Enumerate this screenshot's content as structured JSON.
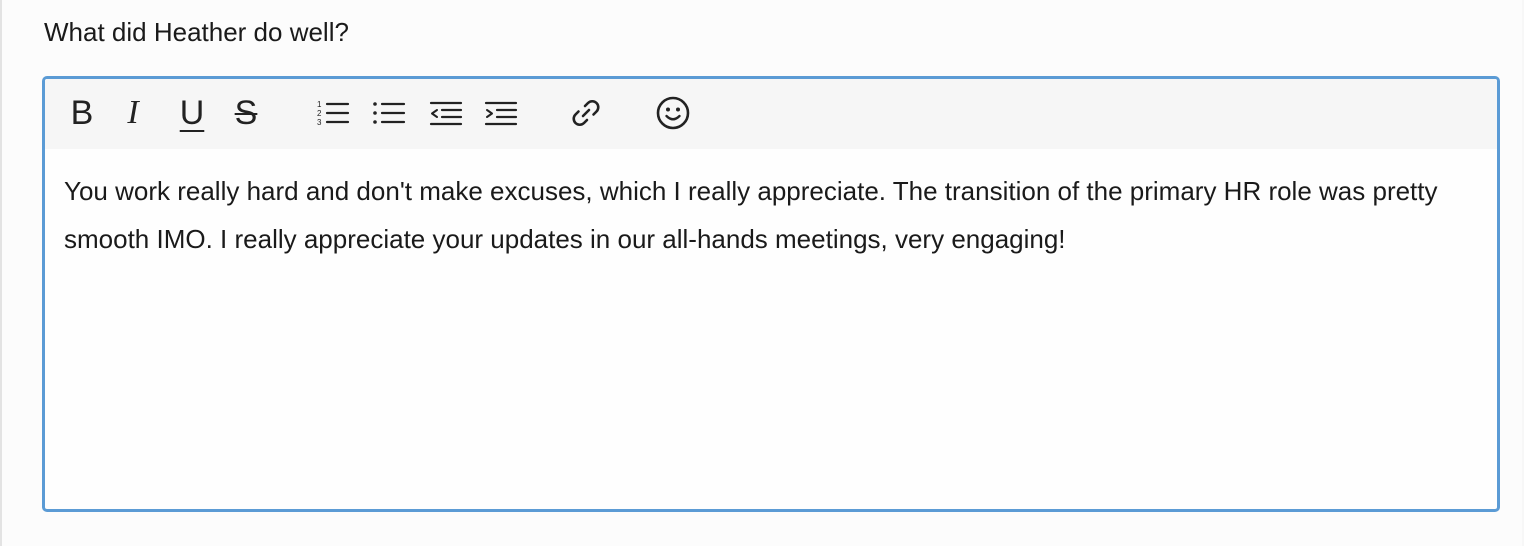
{
  "question": {
    "label": "What did Heather do well?"
  },
  "editor": {
    "toolbar": {
      "bold_glyph": "B",
      "italic_glyph": "I",
      "underline_glyph": "U",
      "strike_glyph": "S",
      "tools": [
        "bold-icon",
        "italic-icon",
        "underline-icon",
        "strikethrough-icon",
        "ordered-list-icon",
        "bullet-list-icon",
        "outdent-icon",
        "indent-icon",
        "link-icon",
        "emoji-icon"
      ]
    },
    "content": "You work really hard and don't make excuses, which I really appreciate. The transition of the primary HR role was pretty smooth IMO. I really appreciate your updates in our all-hands meetings, very engaging!",
    "colors": {
      "focus_border": "#5b9bd5",
      "toolbar_bg": "#f6f6f6"
    }
  }
}
